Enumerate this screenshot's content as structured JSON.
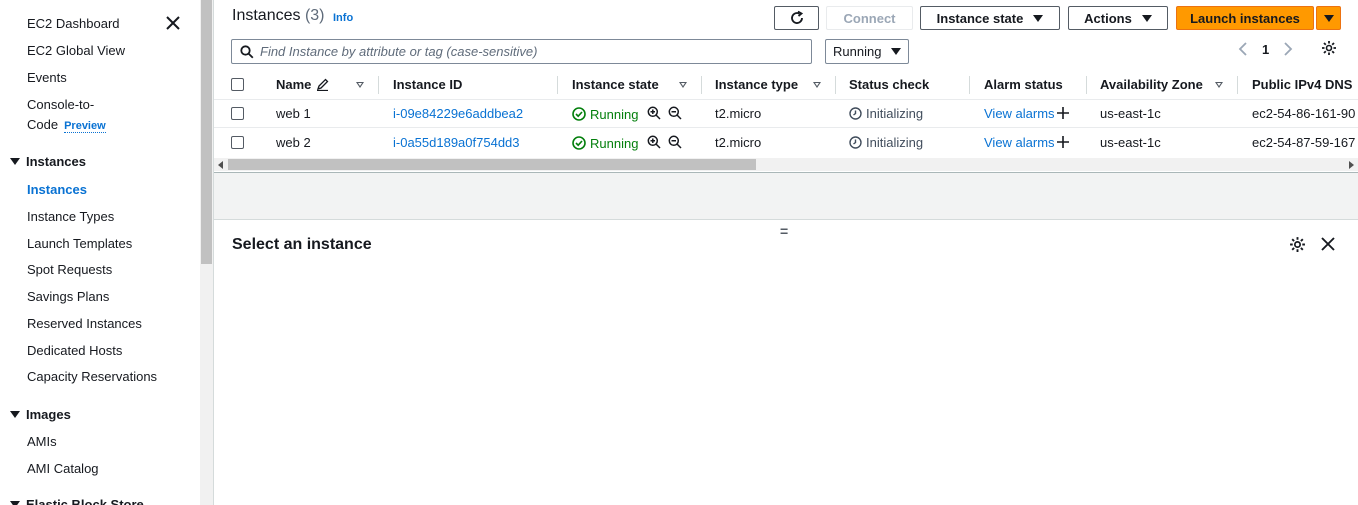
{
  "sidebar": {
    "items_top": [
      {
        "label": "EC2 Dashboard"
      },
      {
        "label": "EC2 Global View"
      },
      {
        "label": "Events"
      },
      {
        "label_line1": "Console-to-",
        "label_line2": "Code",
        "badge": "Preview"
      }
    ],
    "sections": [
      {
        "title": "Instances",
        "items": [
          {
            "label": "Instances",
            "active": true
          },
          {
            "label": "Instance Types"
          },
          {
            "label": "Launch Templates"
          },
          {
            "label": "Spot Requests"
          },
          {
            "label": "Savings Plans"
          },
          {
            "label": "Reserved Instances"
          },
          {
            "label": "Dedicated Hosts"
          },
          {
            "label": "Capacity Reservations"
          }
        ]
      },
      {
        "title": "Images",
        "items": [
          {
            "label": "AMIs"
          },
          {
            "label": "AMI Catalog"
          }
        ]
      },
      {
        "title": "Elastic Block Store",
        "items": []
      }
    ]
  },
  "header": {
    "title": "Instances",
    "count": "(3)",
    "info": "Info",
    "buttons": {
      "refresh": "refresh-icon",
      "connect": "Connect",
      "instance_state": "Instance state",
      "actions": "Actions",
      "launch": "Launch instances"
    }
  },
  "search": {
    "placeholder": "Find Instance by attribute or tag (case-sensitive)",
    "filter_value": "Running"
  },
  "pagination": {
    "current_page": "1"
  },
  "table": {
    "columns": [
      "Name",
      "Instance ID",
      "Instance state",
      "Instance type",
      "Status check",
      "Alarm status",
      "Availability Zone",
      "Public IPv4 DNS"
    ],
    "rows": [
      {
        "name": "web 1",
        "instance_id": "i-09e84229e6addbea2",
        "state": "Running",
        "type": "t2.micro",
        "status_check": "Initializing",
        "alarm": "View alarms",
        "az": "us-east-1c",
        "dns": "ec2-54-86-161-90"
      },
      {
        "name": "web 2",
        "instance_id": "i-0a55d189a0f754dd3",
        "state": "Running",
        "type": "t2.micro",
        "status_check": "Initializing",
        "alarm": "View alarms",
        "az": "us-east-1c",
        "dns": "ec2-54-87-59-167"
      }
    ]
  },
  "details": {
    "title": "Select an instance",
    "drag_handle": "="
  },
  "colors": {
    "link": "#0972d3",
    "running": "#037f0c",
    "primary": "#ff9900"
  }
}
